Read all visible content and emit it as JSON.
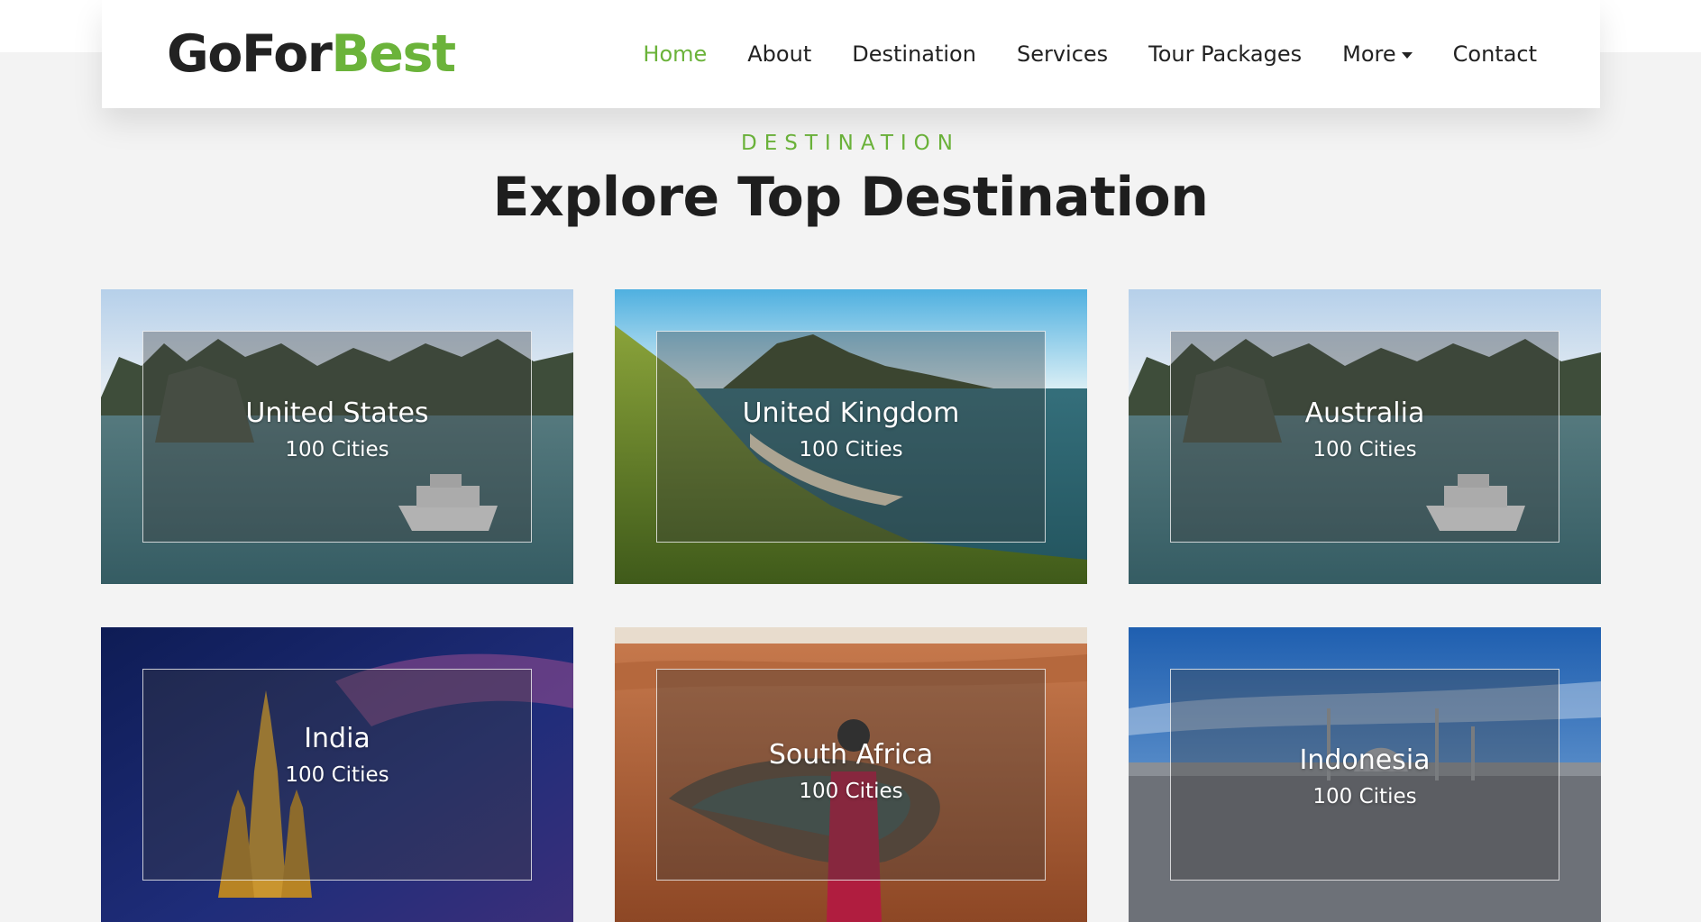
{
  "brand": {
    "part1": "GoFor",
    "part2": "Best"
  },
  "nav": {
    "items": [
      {
        "label": "Home",
        "active": true
      },
      {
        "label": "About",
        "active": false
      },
      {
        "label": "Destination",
        "active": false
      },
      {
        "label": "Services",
        "active": false
      },
      {
        "label": "Tour Packages",
        "active": false
      },
      {
        "label": "More",
        "active": false,
        "dropdown": true
      },
      {
        "label": "Contact",
        "active": false
      }
    ]
  },
  "section": {
    "subtitle": "DESTINATION",
    "title": "Explore Top Destination"
  },
  "cards": [
    {
      "name": "United States",
      "count": "100 Cities",
      "scene": "karst-bay"
    },
    {
      "name": "United Kingdom",
      "count": "100 Cities",
      "scene": "grassy-coast"
    },
    {
      "name": "Australia",
      "count": "100 Cities",
      "scene": "karst-bay"
    },
    {
      "name": "India",
      "count": "100 Cities",
      "scene": "temple-night"
    },
    {
      "name": "South Africa",
      "count": "100 Cities",
      "scene": "canyon"
    },
    {
      "name": "Indonesia",
      "count": "100 Cities",
      "scene": "mosque-skyline"
    }
  ],
  "colors": {
    "accent": "#6bb33a",
    "text": "#222222",
    "background": "#f3f3f3"
  }
}
